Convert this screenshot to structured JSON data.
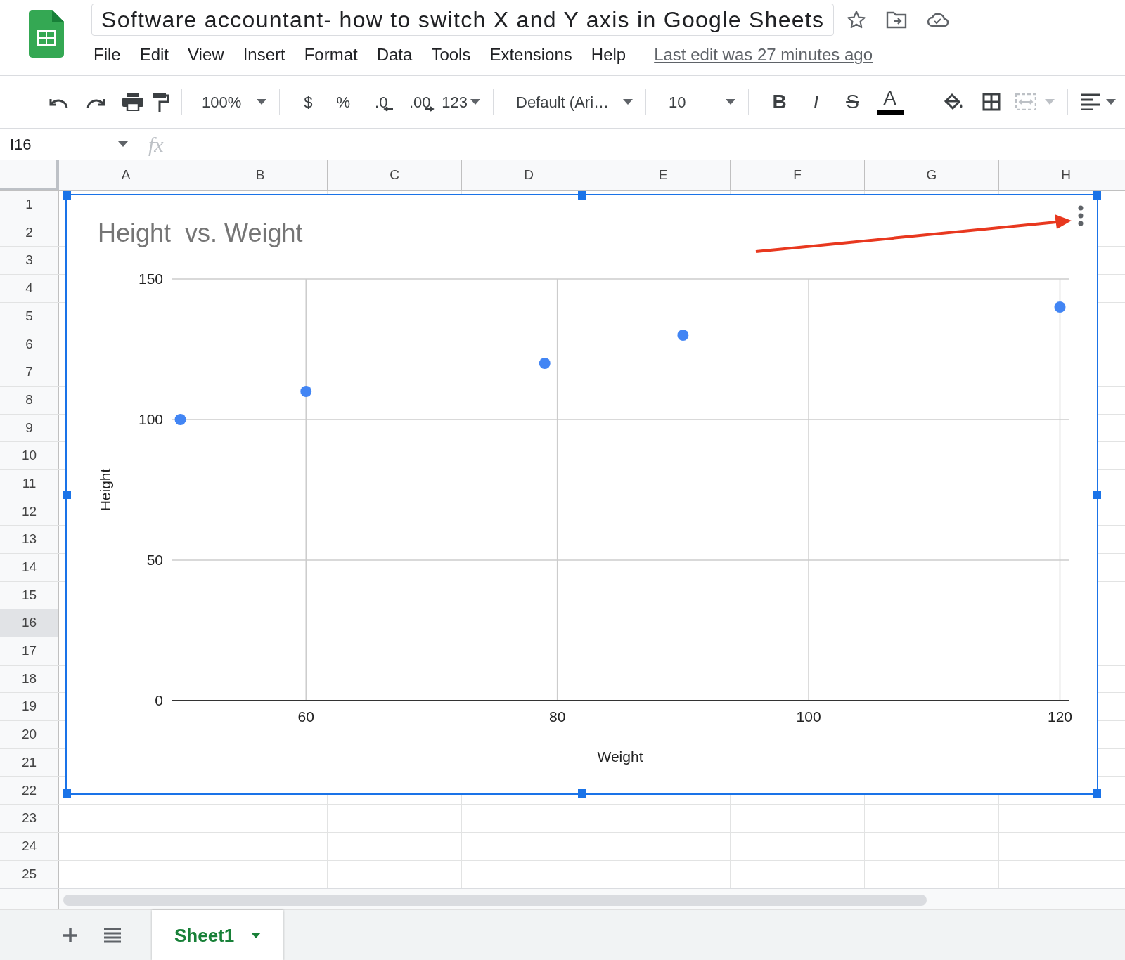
{
  "document": {
    "title": "Software accountant- how to switch X and Y axis in Google Sheets",
    "menu": [
      "File",
      "Edit",
      "View",
      "Insert",
      "Format",
      "Data",
      "Tools",
      "Extensions",
      "Help"
    ],
    "last_edit": "Last edit was 27 minutes ago"
  },
  "toolbar": {
    "zoom": "100%",
    "currency": "$",
    "percent": "%",
    "decrease_decimal": ".0",
    "increase_decimal": ".00",
    "more_formats": "123",
    "font": "Default (Ari…",
    "font_size": "10",
    "bold": "B",
    "italic": "I",
    "strikethrough": "S",
    "text_color": "A"
  },
  "formula_bar": {
    "name_box": "I16",
    "function_symbol": "fx"
  },
  "columns": [
    "A",
    "B",
    "C",
    "D",
    "E",
    "F",
    "G",
    "H"
  ],
  "rows": [
    {
      "label": "1",
      "selected": false
    },
    {
      "label": "2",
      "selected": false
    },
    {
      "label": "3",
      "selected": false
    },
    {
      "label": "4",
      "selected": false
    },
    {
      "label": "5",
      "selected": false
    },
    {
      "label": "6",
      "selected": false
    },
    {
      "label": "7",
      "selected": false
    },
    {
      "label": "8",
      "selected": false
    },
    {
      "label": "9",
      "selected": false
    },
    {
      "label": "10",
      "selected": false
    },
    {
      "label": "11",
      "selected": false
    },
    {
      "label": "12",
      "selected": false
    },
    {
      "label": "13",
      "selected": false
    },
    {
      "label": "14",
      "selected": false
    },
    {
      "label": "15",
      "selected": false
    },
    {
      "label": "16",
      "selected": true
    },
    {
      "label": "17",
      "selected": false
    },
    {
      "label": "18",
      "selected": false
    },
    {
      "label": "19",
      "selected": false
    },
    {
      "label": "20",
      "selected": false
    },
    {
      "label": "21",
      "selected": false
    },
    {
      "label": "22",
      "selected": false
    },
    {
      "label": "23",
      "selected": false
    },
    {
      "label": "24",
      "selected": false
    },
    {
      "label": "25",
      "selected": false
    }
  ],
  "chart": {
    "selected": true,
    "chart_data": {
      "type": "scatter",
      "title": "Height  vs. Weight",
      "xlabel": "Weight",
      "ylabel": "Height",
      "x": [
        50,
        60,
        79,
        90,
        120
      ],
      "grid": true,
      "series": [
        {
          "color": "#4285f4",
          "values": [
            100,
            110,
            120,
            130,
            140
          ]
        }
      ],
      "xlim": [
        49.3,
        120.7
      ],
      "ylim": [
        0,
        150
      ],
      "xticks": [
        60,
        80,
        100,
        120
      ],
      "yticks": [
        0,
        50,
        100,
        150
      ]
    }
  },
  "sheet_tabs": [
    {
      "label": "Sheet1",
      "selected": true
    }
  ]
}
